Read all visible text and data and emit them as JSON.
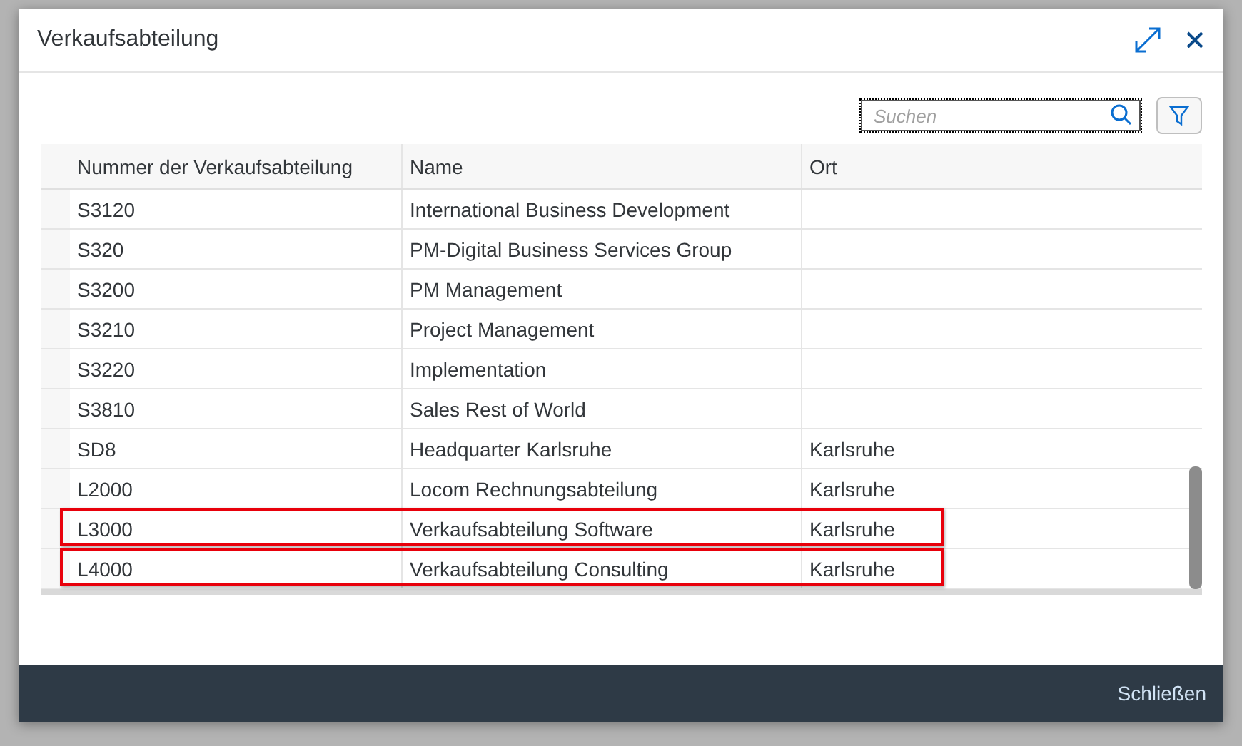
{
  "dialog": {
    "title": "Verkaufsabteilung",
    "search": {
      "placeholder": "Suchen"
    },
    "table": {
      "columns": [
        "Nummer der Verkaufsabteilung",
        "Name",
        "Ort"
      ],
      "rows": [
        {
          "number": "S3120",
          "name": "International Business Development",
          "place": "",
          "highlighted": false
        },
        {
          "number": "S320",
          "name": "PM-Digital Business Services Group",
          "place": "",
          "highlighted": false
        },
        {
          "number": "S3200",
          "name": "PM Management",
          "place": "",
          "highlighted": false
        },
        {
          "number": "S3210",
          "name": "Project Management",
          "place": "",
          "highlighted": false
        },
        {
          "number": "S3220",
          "name": "Implementation",
          "place": "",
          "highlighted": false
        },
        {
          "number": "S3810",
          "name": "Sales Rest of World",
          "place": "",
          "highlighted": false
        },
        {
          "number": "SD8",
          "name": "Headquarter Karlsruhe",
          "place": "Karlsruhe",
          "highlighted": false
        },
        {
          "number": "L2000",
          "name": "Locom Rechnungsabteilung",
          "place": "Karlsruhe",
          "highlighted": false
        },
        {
          "number": "L3000",
          "name": "Verkaufsabteilung Software",
          "place": "Karlsruhe",
          "highlighted": true
        },
        {
          "number": "L4000",
          "name": "Verkaufsabteilung Consulting",
          "place": "Karlsruhe",
          "highlighted": true
        }
      ]
    },
    "footer_button": "Schließen"
  }
}
